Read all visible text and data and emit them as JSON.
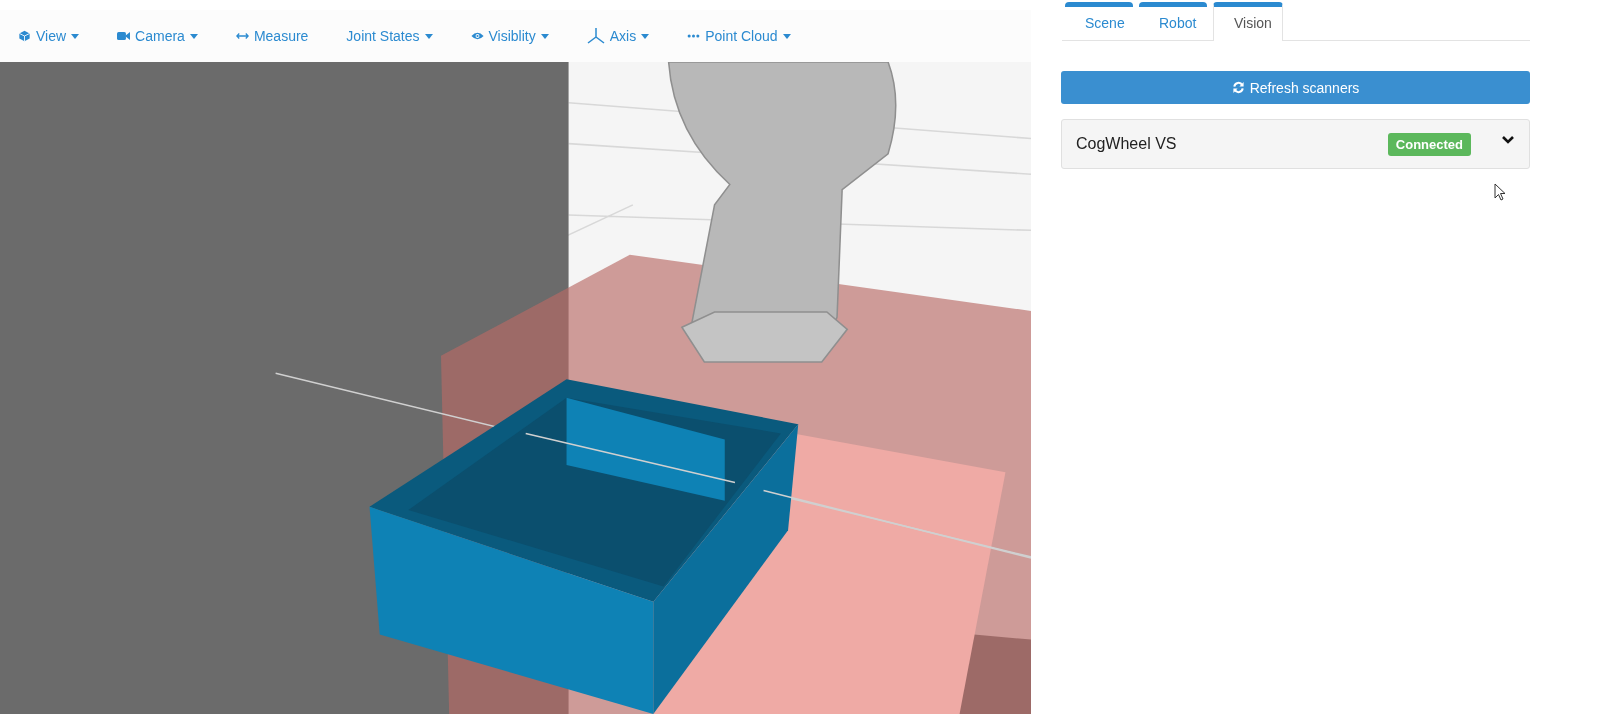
{
  "toolbar": [
    {
      "label": "View",
      "dropdown": true
    },
    {
      "label": "Camera",
      "dropdown": true
    },
    {
      "label": "Measure",
      "dropdown": false
    },
    {
      "label": "Joint States",
      "dropdown": true
    },
    {
      "label": "Visiblity",
      "dropdown": true
    },
    {
      "label": "Axis",
      "dropdown": true
    },
    {
      "label": "Point Cloud",
      "dropdown": true
    }
  ],
  "tabs": [
    {
      "label": "Scene",
      "selected": false
    },
    {
      "label": "Robot",
      "selected": false
    },
    {
      "label": "Vision",
      "selected": true
    }
  ],
  "refresh_button": "Refresh scanners",
  "scanners": [
    {
      "name": "CogWheel VS",
      "status": "Connected",
      "expanded": false
    }
  ]
}
